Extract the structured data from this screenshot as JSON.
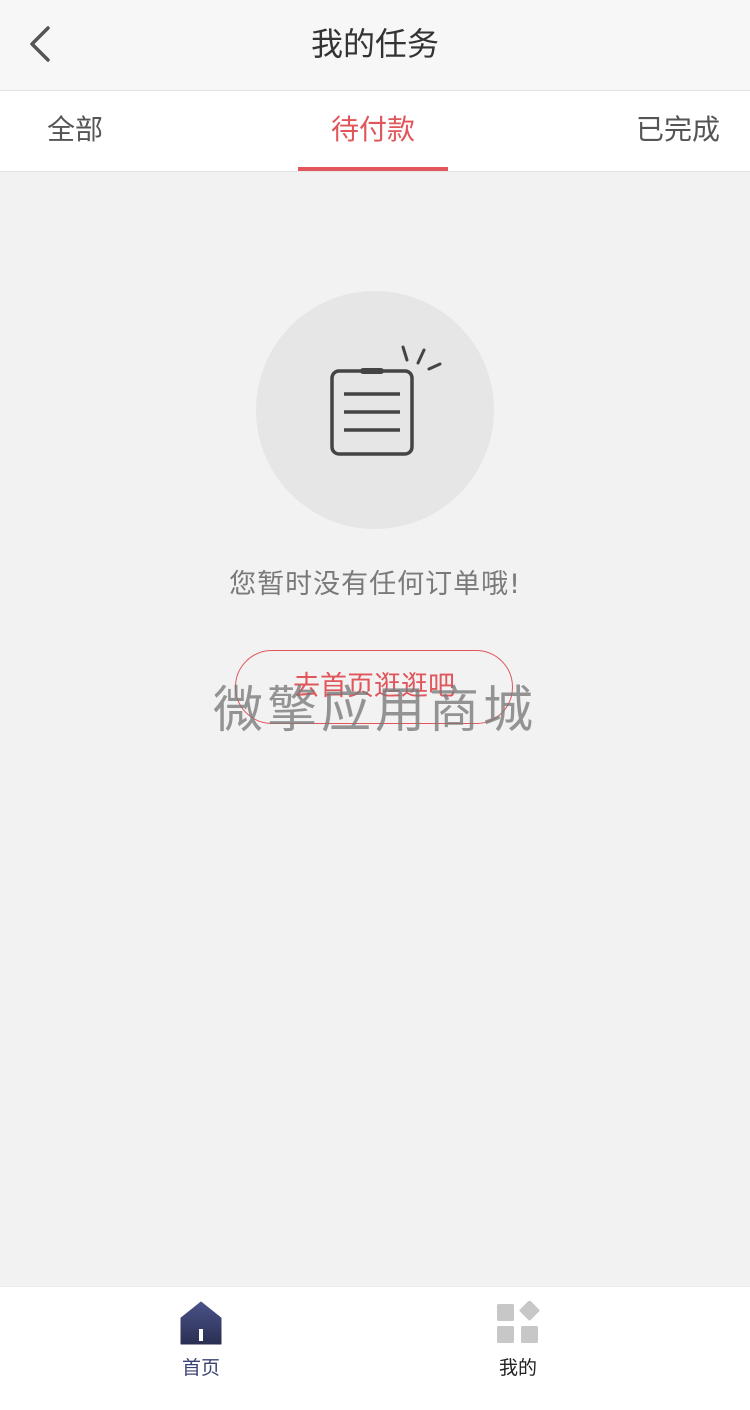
{
  "nav": {
    "title": "我的任务",
    "back_icon": "chevron-left-icon"
  },
  "tabs": [
    {
      "label": "全部",
      "active": false
    },
    {
      "label": "待付款",
      "active": true
    },
    {
      "label": "已完成",
      "active": false
    }
  ],
  "empty_state": {
    "icon": "order-list-icon",
    "message": "您暂时没有任何订单哦!",
    "button_label": "去首页逛逛吧"
  },
  "watermark": "微擎应用商城",
  "bottom_nav": [
    {
      "label": "首页",
      "icon": "home-icon",
      "active": true
    },
    {
      "label": "我的",
      "icon": "grid-icon",
      "active": false
    }
  ],
  "colors": {
    "accent": "#e0565b",
    "active_nav": "#3b4373",
    "background": "#f2f2f2"
  }
}
